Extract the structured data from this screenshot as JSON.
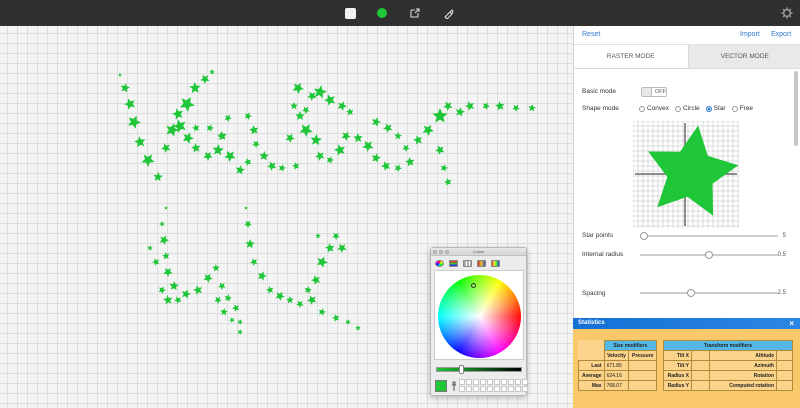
{
  "toolbar": {
    "icons": [
      "white-square-icon",
      "green-color-icon",
      "export-icon",
      "brush-icon",
      "gear-icon"
    ]
  },
  "panel": {
    "reset": "Reset",
    "import": "Import",
    "export": "Export",
    "tabs": {
      "raster": "RASTER MODE",
      "vector": "VECTOR MODE"
    },
    "basic_mode": {
      "label": "Basic mode",
      "state": "OFF"
    },
    "shape_mode": {
      "label": "Shape mode",
      "options": [
        "Convex",
        "Circle",
        "Star",
        "Free"
      ],
      "selected": "Star"
    },
    "star_points": {
      "label": "Star points",
      "value": "5",
      "fraction": 0.0
    },
    "internal_radius": {
      "label": "Internal radius",
      "value": "0.5",
      "fraction": 0.5
    },
    "spacing": {
      "label": "Spacing",
      "value": "2.5",
      "fraction": 0.36
    }
  },
  "color_picker": {
    "title": "Colors",
    "selected_color": "#1fc638"
  },
  "statistics": {
    "title": "Statistics",
    "size_modifiers": {
      "caption": "Size modifiers",
      "columns": [
        "Velocity",
        "Pressure"
      ],
      "rows": [
        {
          "label": "Last",
          "velocity": "671.85",
          "pressure": ""
        },
        {
          "label": "Average",
          "velocity": "624.16",
          "pressure": ""
        },
        {
          "label": "Max",
          "velocity": "768.07",
          "pressure": ""
        }
      ]
    },
    "transform_modifiers": {
      "caption": "Transform modifiers",
      "rows": [
        {
          "left": "Tilt X",
          "right": "Altitude"
        },
        {
          "left": "Tilt Y",
          "right": "Azimuth"
        },
        {
          "left": "Radius X",
          "right": "Rotation"
        },
        {
          "left": "Radius Y",
          "right": "Computed rotation"
        }
      ]
    }
  },
  "brush_color": "#1fc638"
}
